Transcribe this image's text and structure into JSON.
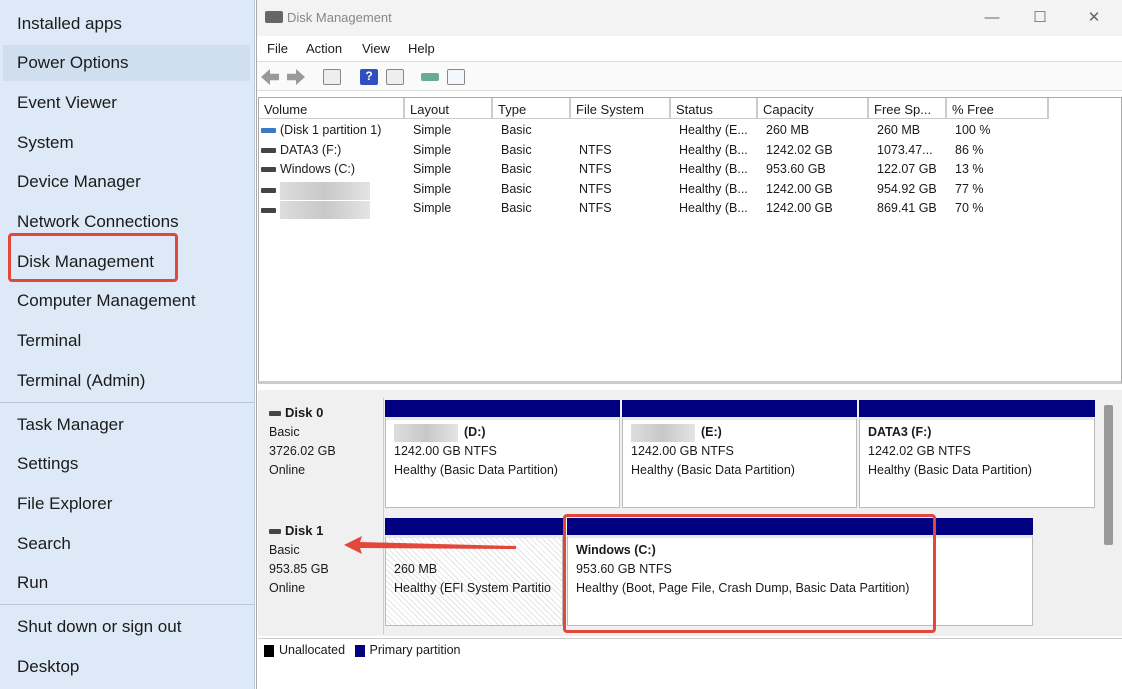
{
  "start_menu": {
    "items": [
      "Installed apps",
      "Power Options",
      "Event Viewer",
      "System",
      "Device Manager",
      "Network Connections",
      "Disk Management",
      "Computer Management",
      "Terminal",
      "Terminal (Admin)",
      "Task Manager",
      "Settings",
      "File Explorer",
      "Search",
      "Run",
      "Shut down or sign out",
      "Desktop"
    ],
    "highlighted": "Power Options",
    "annotated": "Disk Management"
  },
  "window": {
    "title": "Disk Management",
    "controls": [
      "—",
      "☐",
      "✕"
    ]
  },
  "menubar": [
    "File",
    "Action",
    "View",
    "Help"
  ],
  "volume_list": {
    "columns": [
      "Volume",
      "Layout",
      "Type",
      "File System",
      "Status",
      "Capacity",
      "Free Sp...",
      "% Free"
    ],
    "rows": [
      [
        "(Disk 1 partition 1)",
        "Simple",
        "Basic",
        "",
        "Healthy (E...",
        "260 MB",
        "260 MB",
        "100 %"
      ],
      [
        "DATA3 (F:)",
        "Simple",
        "Basic",
        "NTFS",
        "Healthy (B...",
        "1242.02 GB",
        "1073.47...",
        "86 %"
      ],
      [
        "Windows (C:)",
        "Simple",
        "Basic",
        "NTFS",
        "Healthy (B...",
        "953.60 GB",
        "122.07 GB",
        "13 %"
      ],
      [
        "",
        "Simple",
        "Basic",
        "NTFS",
        "Healthy (B...",
        "1242.00 GB",
        "954.92 GB",
        "77 %"
      ],
      [
        "",
        "Simple",
        "Basic",
        "NTFS",
        "Healthy (B...",
        "1242.00 GB",
        "869.41 GB",
        "70 %"
      ]
    ]
  },
  "disks": [
    {
      "name": "Disk 0",
      "type": "Basic",
      "size": "3726.02 GB",
      "status": "Online",
      "partitions": [
        {
          "name": "(D:)",
          "size": "1242.00 GB NTFS",
          "status": "Healthy (Basic Data Partition)"
        },
        {
          "name": "(E:)",
          "size": "1242.00 GB NTFS",
          "status": "Healthy (Basic Data Partition)"
        },
        {
          "name": "DATA3  (F:)",
          "size": "1242.02 GB NTFS",
          "status": "Healthy (Basic Data Partition)"
        }
      ]
    },
    {
      "name": "Disk 1",
      "type": "Basic",
      "size": "953.85 GB",
      "status": "Online",
      "partitions": [
        {
          "name": "",
          "size": "260 MB",
          "status": "Healthy (EFI System Partitio"
        },
        {
          "name": "Windows  (C:)",
          "size": "953.60 GB NTFS",
          "status": "Healthy (Boot, Page File, Crash Dump, Basic Data Partition)"
        }
      ]
    }
  ],
  "legend": [
    "Unallocated",
    "Primary partition"
  ],
  "colors": {
    "primary_partition": "#000080",
    "unallocated": "#000000",
    "annotation": "#e2473a",
    "menu_bg": "#dde9f6"
  }
}
